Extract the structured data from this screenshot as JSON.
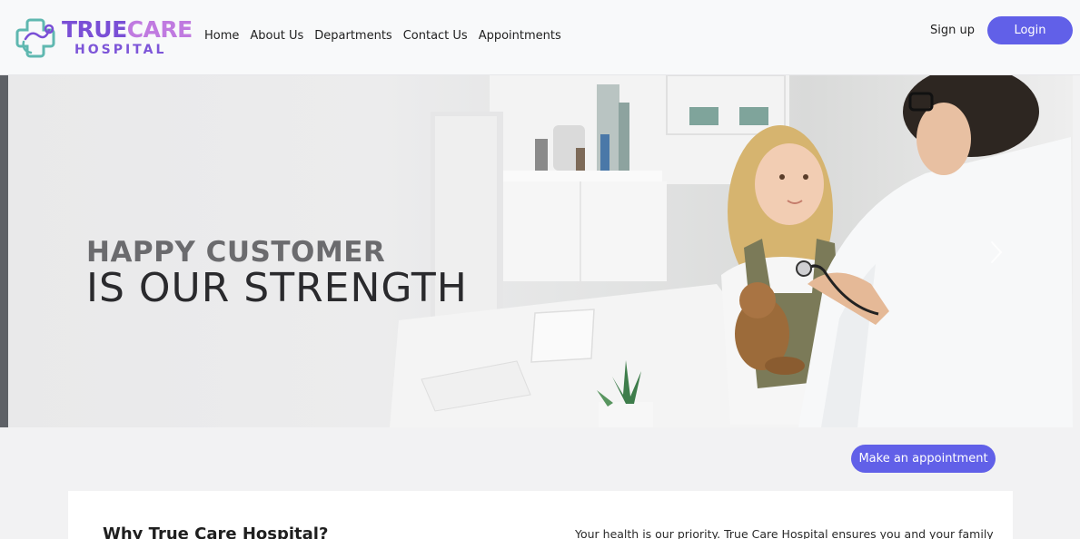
{
  "brand": {
    "word_true": "TRUE",
    "word_care": "CARE",
    "subtitle": "HOSPITAL"
  },
  "nav": {
    "items": [
      {
        "label": "Home"
      },
      {
        "label": "About Us"
      },
      {
        "label": "Departments"
      },
      {
        "label": "Contact Us"
      },
      {
        "label": "Appointments"
      }
    ],
    "signup_label": "Sign up",
    "login_label": "Login"
  },
  "hero": {
    "headline_line1": "HAPPY CUSTOMER",
    "headline_line2": "IS OUR STRENGTH",
    "next_icon": "chevron-right-icon"
  },
  "cta": {
    "appointment_label": "Make an appointment"
  },
  "intro": {
    "title": "Why True Care Hospital?",
    "text": "Your health is our priority. True Care Hospital ensures you and your family"
  },
  "colors": {
    "accent": "#6160e8",
    "brand_purple": "#7a4fd6",
    "brand_teal": "#5fb8b0"
  }
}
